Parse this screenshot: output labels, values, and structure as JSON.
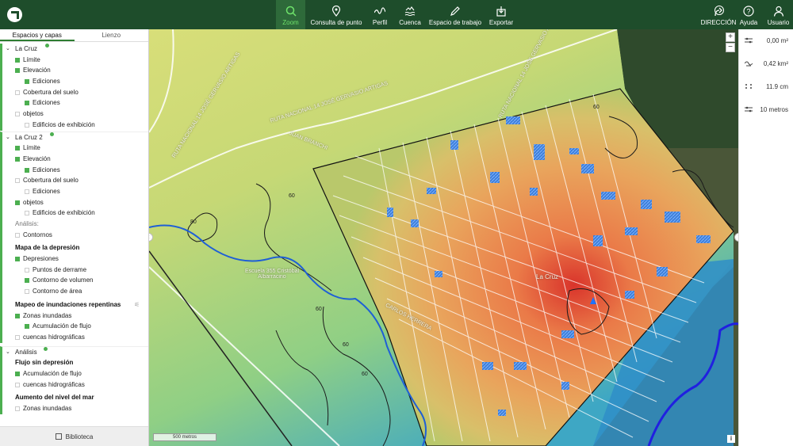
{
  "toolbar": {
    "tools": [
      {
        "label": "Zoom",
        "icon": "search-icon"
      },
      {
        "label": "Consulta de punto",
        "icon": "map-pin-icon"
      },
      {
        "label": "Perfil",
        "icon": "profile-wave-icon"
      },
      {
        "label": "Cuenca",
        "icon": "water-basin-icon"
      },
      {
        "label": "Espacio de trabajo",
        "icon": "pencil-icon"
      },
      {
        "label": "Exportar",
        "icon": "export-icon"
      }
    ],
    "right": [
      {
        "label": "DIRECCIÓN",
        "icon": "direction-icon"
      },
      {
        "label": "Ayuda",
        "icon": "help-icon"
      },
      {
        "label": "Usuario",
        "icon": "user-icon"
      }
    ]
  },
  "panel": {
    "tabs": [
      "Espacios y capas",
      "Lienzo"
    ],
    "groups": [
      {
        "title": "La Cruz",
        "rows": [
          "Límite",
          "Elevación",
          "Ediciones",
          "Cobertura del suelo",
          "Ediciones",
          "objetos",
          "Edificios de exhibición"
        ]
      },
      {
        "title": "La Cruz 2",
        "rows": [
          "Límite",
          "Elevación",
          "Ediciones",
          "Cobertura del suelo",
          "Ediciones",
          "objetos",
          "Edificios de exhibición",
          "Análisis:",
          "Contornos"
        ],
        "sections": [
          {
            "title": "Mapa de la depresión",
            "rows": [
              "Depresiones",
              "Puntos de derrame",
              "Contorno de volumen",
              "Contorno de área"
            ]
          },
          {
            "title": "Mapeo de inundaciones repentinas",
            "rows": [
              "Zonas inundadas",
              "Acumulación de flujo",
              "cuencas hidrográficas"
            ]
          }
        ]
      },
      {
        "title": "Análisis",
        "sections": [
          {
            "title": "Flujo sin depresión",
            "rows": [
              "Acumulación de flujo",
              "cuencas hidrográficas"
            ]
          },
          {
            "title": "Aumento del nivel del mar",
            "rows": [
              "Zonas inundadas"
            ]
          }
        ]
      }
    ],
    "library_label": "Biblioteca"
  },
  "map": {
    "labels": {
      "road1": "RUTA NACIONAL 14 JOSÉ GERVASIO ARTIGAS",
      "road2": "RUTA NACIONAL 14 JOSÉ GERVASIO ARTIGAS",
      "road3": "RUTA NACIONAL 14 JOSE GERVASIO ARTIGAS",
      "street1": "JUAN BRANCHI",
      "street2": "CARLOS HERRERA",
      "school": "Escuela 355 Cristóbal Albarracino",
      "town": "La Cruz"
    },
    "contour_labels": [
      "80",
      "60",
      "60",
      "60",
      "60",
      "60"
    ],
    "scale": "500 metros",
    "zoom_in": "+",
    "zoom_out": "−",
    "info": "i",
    "collapse_left": "‹",
    "collapse_right": "›"
  },
  "measures": [
    {
      "icon": "sliders-icon",
      "value": "0,00 m²"
    },
    {
      "icon": "area-icon",
      "value": "0,42 km²"
    },
    {
      "icon": "points-icon",
      "value": "11.9 cm"
    },
    {
      "icon": "sliders-icon",
      "value": "10 metros"
    }
  ],
  "colors": {
    "toolbar": "#1e4d2b",
    "accent": "#4caf50",
    "active_tool": "#6fe36b"
  }
}
